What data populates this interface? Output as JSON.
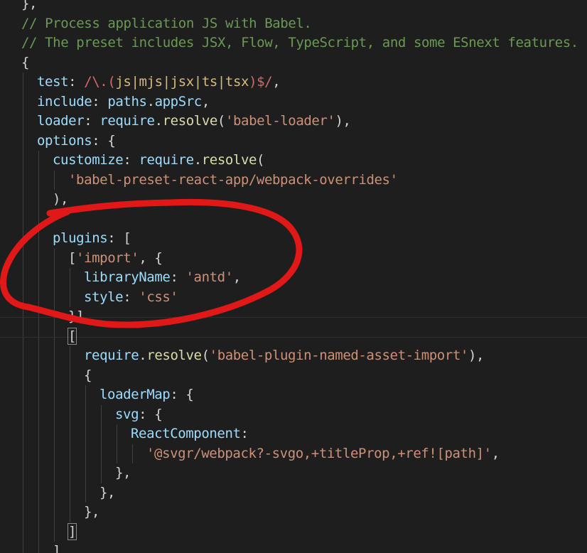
{
  "theme": {
    "background": "#1e1e1e",
    "comment": "#6a9955",
    "property": "#9cdcfe",
    "string": "#ce9178",
    "function": "#dcdcaa",
    "punctuation": "#d4d4d4",
    "regex": "#d16969",
    "annotation": "#e01818"
  },
  "annotation": {
    "shape": "hand-drawn circle",
    "color": "#e01818"
  },
  "lines": [
    {
      "indent": 0,
      "tokens": [
        [
          "p",
          "},"
        ]
      ]
    },
    {
      "indent": 0,
      "tokens": [
        [
          "c",
          "// Process application JS with Babel."
        ]
      ]
    },
    {
      "indent": 0,
      "tokens": [
        [
          "c",
          "// The preset includes JSX, Flow, TypeScript, and some ESnext features."
        ]
      ]
    },
    {
      "indent": 0,
      "tokens": [
        [
          "p",
          "{"
        ]
      ]
    },
    {
      "indent": 1,
      "tokens": [
        [
          "k",
          "test"
        ],
        [
          "p",
          ": "
        ],
        [
          "r",
          "/\\.("
        ],
        [
          "o",
          "js|mjs|jsx|ts|tsx"
        ],
        [
          "r",
          ")$/"
        ],
        [
          "p",
          ","
        ]
      ]
    },
    {
      "indent": 1,
      "tokens": [
        [
          "k",
          "include"
        ],
        [
          "p",
          ": "
        ],
        [
          "k",
          "paths"
        ],
        [
          "p",
          "."
        ],
        [
          "k",
          "appSrc"
        ],
        [
          "p",
          ","
        ]
      ]
    },
    {
      "indent": 1,
      "tokens": [
        [
          "k",
          "loader"
        ],
        [
          "p",
          ": "
        ],
        [
          "k",
          "require"
        ],
        [
          "p",
          "."
        ],
        [
          "f",
          "resolve"
        ],
        [
          "p",
          "("
        ],
        [
          "s",
          "'babel-loader'"
        ],
        [
          "p",
          "),"
        ]
      ]
    },
    {
      "indent": 1,
      "tokens": [
        [
          "k",
          "options"
        ],
        [
          "p",
          ": {"
        ]
      ]
    },
    {
      "indent": 2,
      "tokens": [
        [
          "k",
          "customize"
        ],
        [
          "p",
          ": "
        ],
        [
          "k",
          "require"
        ],
        [
          "p",
          "."
        ],
        [
          "f",
          "resolve"
        ],
        [
          "p",
          "("
        ]
      ]
    },
    {
      "indent": 3,
      "tokens": [
        [
          "s",
          "'babel-preset-react-app/webpack-overrides'"
        ]
      ]
    },
    {
      "indent": 2,
      "tokens": [
        [
          "p",
          "),"
        ]
      ]
    },
    {
      "indent": 0,
      "tokens": []
    },
    {
      "indent": 2,
      "tokens": [
        [
          "k",
          "plugins"
        ],
        [
          "p",
          ": ["
        ]
      ]
    },
    {
      "indent": 3,
      "tokens": [
        [
          "p",
          "["
        ],
        [
          "s",
          "'import'"
        ],
        [
          "p",
          ", {"
        ]
      ]
    },
    {
      "indent": 4,
      "tokens": [
        [
          "k",
          "libraryName"
        ],
        [
          "p",
          ": "
        ],
        [
          "s",
          "'antd'"
        ],
        [
          "p",
          ","
        ]
      ]
    },
    {
      "indent": 4,
      "tokens": [
        [
          "k",
          "style"
        ],
        [
          "p",
          ": "
        ],
        [
          "s",
          "'css'"
        ]
      ]
    },
    {
      "indent": 3,
      "tokens": [
        [
          "p",
          "}],"
        ]
      ]
    },
    {
      "indent": 3,
      "tokens": [
        [
          "b",
          "["
        ]
      ]
    },
    {
      "indent": 4,
      "tokens": [
        [
          "k",
          "require"
        ],
        [
          "p",
          "."
        ],
        [
          "f",
          "resolve"
        ],
        [
          "p",
          "("
        ],
        [
          "s",
          "'babel-plugin-named-asset-import'"
        ],
        [
          "p",
          "),"
        ]
      ]
    },
    {
      "indent": 4,
      "tokens": [
        [
          "p",
          "{"
        ]
      ]
    },
    {
      "indent": 5,
      "tokens": [
        [
          "k",
          "loaderMap"
        ],
        [
          "p",
          ": {"
        ]
      ]
    },
    {
      "indent": 6,
      "tokens": [
        [
          "k",
          "svg"
        ],
        [
          "p",
          ": {"
        ]
      ]
    },
    {
      "indent": 7,
      "tokens": [
        [
          "k",
          "ReactComponent"
        ],
        [
          "p",
          ":"
        ]
      ]
    },
    {
      "indent": 8,
      "tokens": [
        [
          "s",
          "'@svgr/webpack?-svgo,+titleProp,+ref![path]'"
        ],
        [
          "p",
          ","
        ]
      ]
    },
    {
      "indent": 6,
      "tokens": [
        [
          "p",
          "},"
        ]
      ]
    },
    {
      "indent": 5,
      "tokens": [
        [
          "p",
          "},"
        ]
      ]
    },
    {
      "indent": 4,
      "tokens": [
        [
          "p",
          "},"
        ]
      ]
    },
    {
      "indent": 3,
      "tokens": [
        [
          "b",
          "]"
        ]
      ]
    },
    {
      "indent": 2,
      "tokens": [
        [
          "p",
          "],"
        ]
      ]
    }
  ]
}
